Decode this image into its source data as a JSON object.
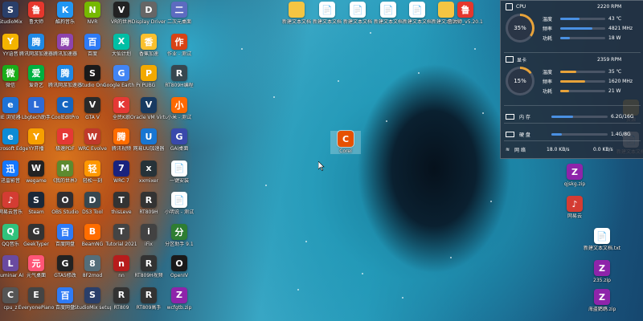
{
  "monitor": {
    "cpu": {
      "title": "CPU",
      "freq": "2220 RPM",
      "percent_label": "35%",
      "percent": 0.35,
      "rows": [
        {
          "label": "温度",
          "value": "43 ℃",
          "fill": 0.43
        },
        {
          "label": "频率",
          "value": "4821 MHz",
          "fill": 0.72
        },
        {
          "label": "功耗",
          "value": "18 W",
          "fill": 0.22
        }
      ]
    },
    "gpu": {
      "title": "显卡",
      "freq": "2359 RPM",
      "percent_label": "15%",
      "percent": 0.15,
      "rows": [
        {
          "label": "温度",
          "value": "35 ℃",
          "fill": 0.35
        },
        {
          "label": "频率",
          "value": "1620 MHz",
          "fill": 0.55
        },
        {
          "label": "功耗",
          "value": "21 W",
          "fill": 0.2
        }
      ]
    },
    "memory": {
      "label": "内 存",
      "value": "6.2G/16G",
      "fill": 0.39
    },
    "disk": {
      "label": "硬 盘",
      "value": "1.4G/8G",
      "fill": 0.18
    },
    "network": {
      "label": "网 络",
      "down": "18.0 KB/s",
      "up": "0.0 KB/s"
    }
  },
  "desktop": {
    "icons": [
      {
        "label": "StudioMix",
        "color": "#2a3f6a",
        "glyph": "S"
      },
      {
        "label": "YY语音",
        "color": "#f4b400",
        "glyph": "Y"
      },
      {
        "label": "微信",
        "color": "#1aad19",
        "glyph": "微"
      },
      {
        "label": "IE 浏览器",
        "color": "#1e73d6",
        "glyph": "e"
      },
      {
        "label": "Microsoft Edge",
        "color": "#0c8bd6",
        "glyph": "e"
      },
      {
        "label": "迅雷影音",
        "color": "#1477ff",
        "glyph": "迅"
      },
      {
        "label": "网易云音乐",
        "color": "#d43c33",
        "glyph": "♪"
      },
      {
        "label": "QQ音乐",
        "color": "#31c27c",
        "glyph": "Q"
      },
      {
        "label": "Luminar AI",
        "color": "#6a4aa0",
        "glyph": "L"
      },
      {
        "label": "cpu_z",
        "color": "#555555",
        "glyph": "C"
      },
      {
        "label": "鲁大师",
        "color": "#e5372d",
        "glyph": "鲁"
      },
      {
        "label": "腾讯网游加速器",
        "color": "#1e88e5",
        "glyph": "腾"
      },
      {
        "label": "爱奇艺",
        "color": "#00b140",
        "glyph": "爱"
      },
      {
        "label": "Lbgtech助手",
        "color": "#2d6bd6",
        "glyph": "L"
      },
      {
        "label": "YY开播",
        "color": "#f7a000",
        "glyph": "Y"
      },
      {
        "label": "wegame",
        "color": "#222222",
        "glyph": "W"
      },
      {
        "label": "Steam",
        "color": "#1b2838",
        "glyph": "S"
      },
      {
        "label": "GeekTyper",
        "color": "#333333",
        "glyph": "G"
      },
      {
        "label": "元气桌面",
        "color": "#ff5577",
        "glyph": "元"
      },
      {
        "label": "EveryonePiano",
        "color": "#444444",
        "glyph": "E"
      },
      {
        "label": "酷狗音乐",
        "color": "#2196f3",
        "glyph": "K"
      },
      {
        "label": "腾讯加速器",
        "color": "#8e44ad",
        "glyph": "腾"
      },
      {
        "label": "腾讯网游加速器",
        "color": "#1e88e5",
        "glyph": "腾"
      },
      {
        "label": "CoolEditPro",
        "color": "#1565c0",
        "glyph": "C"
      },
      {
        "label": "极速PDF",
        "color": "#e53935",
        "glyph": "P"
      },
      {
        "label": "《我的世界》",
        "color": "#5d8a2f",
        "glyph": "M"
      },
      {
        "label": "OBS Studio",
        "color": "#302e31",
        "glyph": "O"
      },
      {
        "label": "百度网盘",
        "color": "#2e7bf6",
        "glyph": "百"
      },
      {
        "label": "GTA5修改",
        "color": "#222222",
        "glyph": "G"
      },
      {
        "label": "百度网盘",
        "color": "#2e7bf6",
        "glyph": "百"
      },
      {
        "label": "NVR",
        "color": "#76b900",
        "glyph": "N"
      },
      {
        "label": "百度",
        "color": "#2e7bf6",
        "glyph": "百"
      },
      {
        "label": "Studio One",
        "color": "#1a1a1a",
        "glyph": "S"
      },
      {
        "label": "GTA V",
        "color": "#2a2a2a",
        "glyph": "V"
      },
      {
        "label": "WRC Evolve",
        "color": "#c0392b",
        "glyph": "W"
      },
      {
        "label": "轻松一刻",
        "color": "#ff9800",
        "glyph": "轻"
      },
      {
        "label": "DS3 Tool",
        "color": "#37474f",
        "glyph": "D"
      },
      {
        "label": "BeamNG",
        "color": "#ff6d00",
        "glyph": "B"
      },
      {
        "label": "8F2mod",
        "color": "#546e7a",
        "glyph": "8"
      },
      {
        "label": "StudioMix setup",
        "color": "#2a3f6a",
        "glyph": "S"
      },
      {
        "label": "VR的世界",
        "color": "#222222",
        "glyph": "V"
      },
      {
        "label": "大仙计划",
        "color": "#00bfa5",
        "glyph": "X"
      },
      {
        "label": "Google Earth Pro",
        "color": "#4285f4",
        "glyph": "G"
      },
      {
        "label": "全民K歌",
        "color": "#e53935",
        "glyph": "K"
      },
      {
        "label": "腾讯视频",
        "color": "#ff6d00",
        "glyph": "腾"
      },
      {
        "label": "WRC 7",
        "color": "#1a237e",
        "glyph": "7"
      },
      {
        "label": "thisLeve",
        "color": "#333333",
        "glyph": "T"
      },
      {
        "label": "Tutorial 2021",
        "color": "#444444",
        "glyph": "T"
      },
      {
        "label": "nn",
        "color": "#b71c1c",
        "glyph": "n"
      },
      {
        "label": "RT809",
        "color": "#333333",
        "glyph": "R"
      },
      {
        "label": "Display Driver",
        "color": "#666666",
        "glyph": "D"
      },
      {
        "label": "香蕉加速",
        "color": "#fbc02d",
        "glyph": "香"
      },
      {
        "label": "PUBG",
        "color": "#f2a900",
        "glyph": "P"
      },
      {
        "label": "Oracle VM VirtualBox",
        "color": "#183a61",
        "glyph": "V"
      },
      {
        "label": "网易UU加速器",
        "color": "#1976d2",
        "glyph": "U"
      },
      {
        "label": "xxmixer",
        "color": "#263238",
        "glyph": "x"
      },
      {
        "label": "RT809H",
        "color": "#333333",
        "glyph": "R"
      },
      {
        "label": "iFix",
        "color": "#424242",
        "glyph": "i"
      },
      {
        "label": "RT809H视频",
        "color": "#333333",
        "glyph": "R"
      },
      {
        "label": "RT809高手",
        "color": "#333333",
        "glyph": "R"
      },
      {
        "label": "二次元桌面",
        "color": "#5c6bc0",
        "glyph": "二"
      },
      {
        "label": "作业 - 测试",
        "color": "#d84315",
        "glyph": "作"
      },
      {
        "label": "RT809H编程",
        "color": "#37474f",
        "glyph": "R"
      },
      {
        "label": "小米 - 测试",
        "color": "#ff6900",
        "glyph": "小"
      },
      {
        "label": "GAI桌面",
        "color": "#3949ab",
        "glyph": "G"
      },
      {
        "label": "一键安装",
        "color": "#ffffff",
        "glyph": "📄"
      },
      {
        "label": "小明说 - 测试",
        "color": "#ffffff",
        "glyph": "📄"
      },
      {
        "label": "分区助手 9.1",
        "color": "#2e7d32",
        "glyph": "分"
      },
      {
        "label": "OpenIV",
        "color": "#1a1a1a",
        "glyph": "O"
      },
      {
        "label": "wcfgtb.zip",
        "color": "#8e24aa",
        "glyph": "Z"
      }
    ],
    "right_icons": [
      {
        "label": "鲁大师_v5.20.1",
        "color": "#e5372d",
        "glyph": "鲁"
      },
      {
        "label": "资源",
        "color": "#f4c542",
        "glyph": ""
      },
      {
        "label": "新建文本文档",
        "color": "#ffffff",
        "glyph": "📄"
      },
      {
        "label": "qjskg.zip",
        "color": "#8e24aa",
        "glyph": "Z"
      },
      {
        "label": "网易云",
        "color": "#d43c33",
        "glyph": "♪"
      },
      {
        "label": "新建文本文档.txt",
        "color": "#ffffff",
        "glyph": "📄"
      },
      {
        "label": "235.zip",
        "color": "#8e24aa",
        "glyph": "Z"
      },
      {
        "label": "海盗鹦鹉.zip",
        "color": "#8e24aa",
        "glyph": "Z"
      }
    ],
    "selected_icon": {
      "label": "Corel",
      "color": "#e65100",
      "glyph": "C"
    }
  }
}
